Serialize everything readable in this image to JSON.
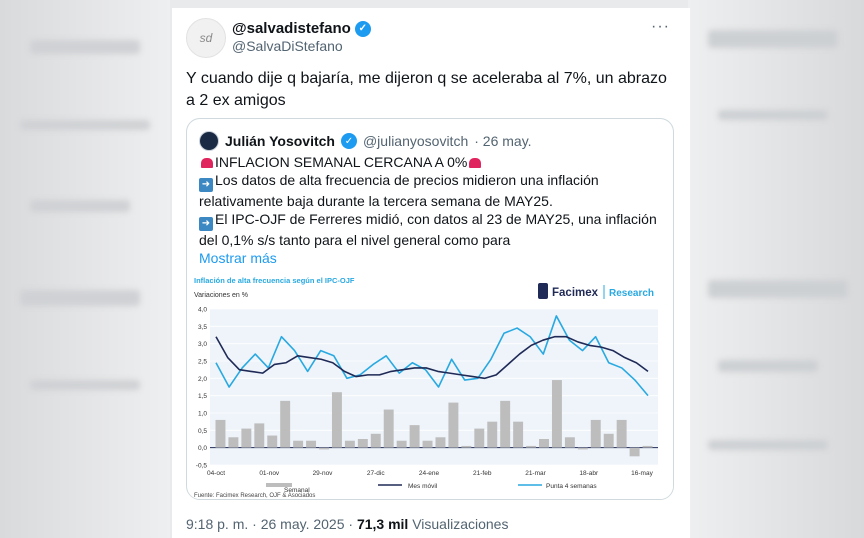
{
  "tweet": {
    "display_name": "@salvadistefano",
    "handle": "@SalvaDiStefano",
    "avatar_text": "sd",
    "text": "Y cuando dije q bajaría, me dijeron q se aceleraba al 7%, un abrazo a 2 ex amigos",
    "more": "···",
    "footer_time": "9:18 p. m. · 26 may. 2025 · ",
    "footer_views": "71,3 mil",
    "footer_views_label": " Visualizaciones"
  },
  "quote": {
    "display_name": "Julián Yosovitch",
    "handle": "@julianyosovitch",
    "date": "· 26 may.",
    "line1": "INFLACION SEMANAL CERCANA A 0%",
    "line2": "Los datos de alta frecuencia de precios midieron una inflación relativamente baja durante la tercera semana de MAY25.",
    "line3": "El IPC-OJF de Ferreres midió, con datos al 23 de MAY25, una inflación del 0,1% s/s tanto para el nivel general como para",
    "show_more": "Mostrar más"
  },
  "colors": {
    "accent": "#1d9bf0",
    "bar": "#bdbdbd",
    "line_month": "#1f2a56",
    "line_4w": "#29a9e1"
  },
  "chart_data": {
    "type": "bar",
    "title": "Inflación de alta frecuencia según el IPC-OJF",
    "subtitle": "Variaciones en %",
    "brand": "Facimex",
    "brand_research": "Research",
    "source": "Fuente: Facimex Research, OJF & Asociados",
    "ylim": [
      -0.5,
      4.0
    ],
    "yticks": [
      "4,0",
      "3,5",
      "3,0",
      "2,5",
      "2,0",
      "1,5",
      "1,0",
      "0,5",
      "0,0",
      "-0,5"
    ],
    "xticks": [
      "04-oct",
      "01-nov",
      "29-nov",
      "27-dic",
      "24-ene",
      "21-feb",
      "21-mar",
      "18-abr",
      "16-may"
    ],
    "legend": [
      "Semanal",
      "Mes móvil",
      "Punta 4 semanas"
    ],
    "series": [
      {
        "name": "Semanal",
        "type": "bar",
        "values": [
          0.8,
          0.3,
          0.55,
          0.7,
          0.35,
          1.35,
          0.2,
          0.2,
          -0.05,
          1.6,
          0.2,
          0.25,
          0.4,
          1.1,
          0.2,
          0.65,
          0.2,
          0.3,
          1.3,
          0.05,
          0.55,
          0.75,
          1.35,
          0.75,
          0.05,
          0.25,
          1.95,
          0.3,
          -0.05,
          0.8,
          0.4,
          0.8,
          -0.25,
          0.05
        ]
      },
      {
        "name": "Mes móvil",
        "type": "line",
        "values": [
          3.2,
          2.6,
          2.25,
          2.2,
          2.15,
          2.4,
          2.45,
          2.65,
          2.6,
          2.55,
          2.45,
          2.2,
          2.05,
          2.1,
          2.1,
          2.2,
          2.25,
          2.3,
          2.3,
          2.2,
          2.15,
          2.1,
          2.05,
          2.0,
          2.1,
          2.4,
          2.7,
          2.95,
          3.1,
          3.2,
          3.2,
          3.05,
          2.95,
          2.9,
          2.8,
          2.6,
          2.45,
          2.2
        ]
      },
      {
        "name": "Punta 4 semanas",
        "type": "line",
        "values": [
          2.45,
          1.75,
          2.3,
          2.7,
          2.3,
          3.2,
          2.8,
          2.2,
          2.8,
          2.65,
          2.0,
          2.1,
          2.4,
          2.65,
          2.15,
          2.45,
          2.25,
          1.75,
          2.55,
          1.95,
          2.0,
          2.55,
          3.3,
          3.45,
          3.2,
          2.7,
          3.8,
          3.1,
          2.8,
          3.2,
          2.45,
          2.3,
          1.95,
          1.5
        ]
      }
    ]
  }
}
